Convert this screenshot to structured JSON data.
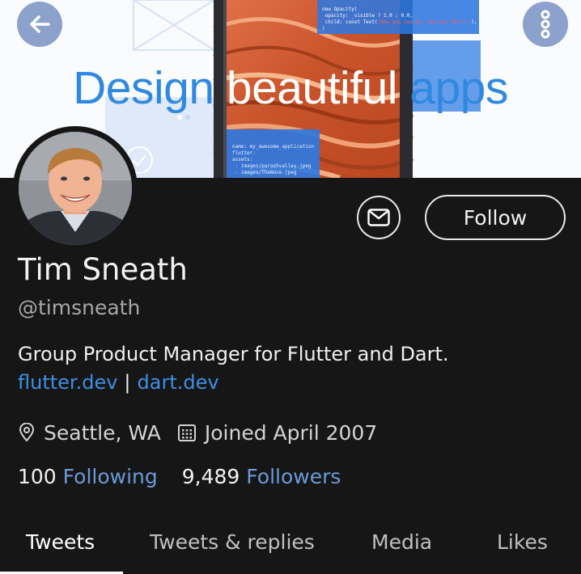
{
  "banner": {
    "headline_part1": "Design",
    "headline_part2": " beautiful",
    "headline_part3": " apps",
    "code_top": "new Opacity(\n opacity: _visible ? 1.0 : 0.0,\n child: const Text(",
    "code_top_red": "'Now you see me, now you don't!'",
    "code_top_end": "),\n)",
    "code_bottom": "name: my_awesome_application\nflutter:\nassets:\n - images/parashvalley.jpeg\n - images/TheWave.jpeg"
  },
  "header": {
    "back_icon": "back-arrow-icon",
    "more_icon": "more-vertical-icon"
  },
  "profile": {
    "avatar": "profile-photo",
    "name": "Tim Sneath",
    "handle": "@timsneath",
    "bio": "Group Product Manager for Flutter and Dart.",
    "link1": "flutter.dev",
    "link_separator": "|",
    "link2": "dart.dev",
    "location": "Seattle, WA",
    "joined": "Joined April 2007",
    "following_count": "100",
    "following_label": "Following",
    "followers_count": "9,489",
    "followers_label": "Followers"
  },
  "actions": {
    "message_icon": "envelope-icon",
    "follow_label": "Follow"
  },
  "tabs": [
    {
      "label": "Tweets",
      "active": true
    },
    {
      "label": "Tweets & replies",
      "active": false
    },
    {
      "label": "Media",
      "active": false
    },
    {
      "label": "Likes",
      "active": false
    }
  ],
  "colors": {
    "background": "#161616",
    "link": "#3d8fe6",
    "banner_headline": "#2f89e0",
    "header_button": "#8ca2cc"
  }
}
